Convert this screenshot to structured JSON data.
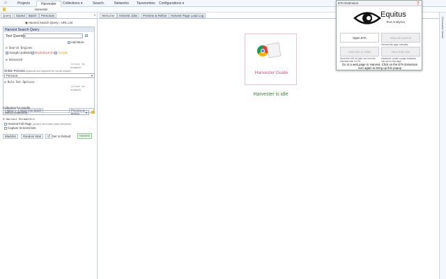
{
  "nav": {
    "items": [
      "Projects",
      "Harvester",
      "Collections ▾",
      "Search",
      "Networks",
      "Taxonomies",
      "Configurations ▾"
    ],
    "active": 1
  },
  "breadcrumb": "Harvester",
  "left_tabs": [
    "Query",
    "Saved",
    "Batch",
    "Personas"
  ],
  "main_tabs": [
    "Welcome",
    "Harvest Jobs",
    "Preview & Refine",
    "Harvest Page Load Log"
  ],
  "query": {
    "mode_options": [
      "Harvest Search Query",
      "URL List"
    ],
    "panel_title": "Harvest Search Query",
    "text_queries_label": "Text Queries:",
    "add_more": "Add More",
    "search_engines_label": "Search Engines",
    "engines": [
      {
        "name": "Google Updated",
        "color": "#333333"
      },
      {
        "name": "Duck Duck Go",
        "color": "#d9442c"
      },
      {
        "name": "Google",
        "color": "#e3a11b"
      }
    ],
    "advanced_label": "Advanced",
    "click_expand": "(click to expand)",
    "persona_label": "Online Persona",
    "persona_hint": "(optional but required for social media)",
    "persona_value": "Persona",
    "rule_set_label": "Rule Set Options",
    "save": "Save",
    "copy_batch": "Copy into Batch",
    "preview": "Preview & Refine"
  },
  "collection": {
    "label": "Collection for results",
    "placeholder": "Select Collection...",
    "params_label": "Harvest Parameters",
    "full_page": "Harvest Full Page",
    "full_page_hint": "(content and boiler plate elements)",
    "screenshots": "Capture Screenshots",
    "blacklist": "Blacklist",
    "random_wait": "Random Wait",
    "set_default": "Set to Default",
    "harvest": "Harvest"
  },
  "welcome": {
    "guide": "Harvester Guide",
    "status": "Harvester is idle"
  },
  "right_strip": "Document Viewer",
  "popup": {
    "title": "ETA Extension",
    "brand": "Equitus",
    "tagline": "Text Analytics",
    "open": "Open ETA",
    "manual": "Manual Harvest",
    "manual_hint": "Harvest this page manually",
    "add_url": "Add URL to Slate",
    "add_url_hint": "Store this URL for later use from the Harvester tab in ETA",
    "rule": "New Rule Set",
    "rule_hint": "Advanced: create a page extraction rule set for this page",
    "footer": "Go to a web page to Harvest. Click on the ETA Extension icon again to bring up this popup"
  }
}
